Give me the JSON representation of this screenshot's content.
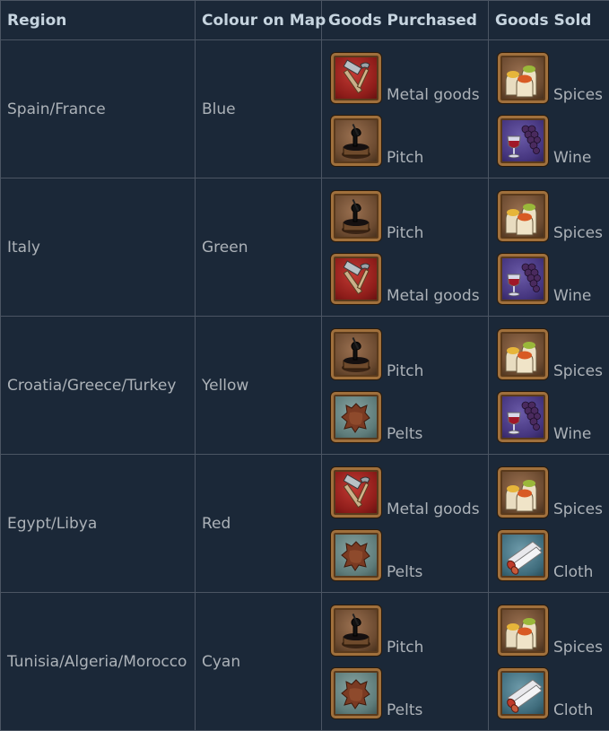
{
  "headers": {
    "region": "Region",
    "colour": "Colour on Map",
    "purchased": "Goods Purchased",
    "sold": "Goods Sold"
  },
  "rows": [
    {
      "region": "Spain/France",
      "colour": "Blue",
      "purchased": [
        {
          "label": "Metal goods",
          "icon": "metal-goods-icon"
        },
        {
          "label": "Pitch",
          "icon": "pitch-icon"
        }
      ],
      "sold": [
        {
          "label": "Spices",
          "icon": "spices-icon"
        },
        {
          "label": "Wine",
          "icon": "wine-icon"
        }
      ]
    },
    {
      "region": "Italy",
      "colour": "Green",
      "purchased": [
        {
          "label": "Pitch",
          "icon": "pitch-icon"
        },
        {
          "label": "Metal goods",
          "icon": "metal-goods-icon"
        }
      ],
      "sold": [
        {
          "label": "Spices",
          "icon": "spices-icon"
        },
        {
          "label": "Wine",
          "icon": "wine-icon"
        }
      ]
    },
    {
      "region": "Croatia/Greece/Turkey",
      "colour": "Yellow",
      "purchased": [
        {
          "label": "Pitch",
          "icon": "pitch-icon"
        },
        {
          "label": "Pelts",
          "icon": "pelts-icon"
        }
      ],
      "sold": [
        {
          "label": "Spices",
          "icon": "spices-icon"
        },
        {
          "label": "Wine",
          "icon": "wine-icon"
        }
      ]
    },
    {
      "region": "Egypt/Libya",
      "colour": "Red",
      "purchased": [
        {
          "label": "Metal goods",
          "icon": "metal-goods-icon"
        },
        {
          "label": "Pelts",
          "icon": "pelts-icon"
        }
      ],
      "sold": [
        {
          "label": "Spices",
          "icon": "spices-icon"
        },
        {
          "label": "Cloth",
          "icon": "cloth-icon"
        }
      ]
    },
    {
      "region": "Tunisia/Algeria/Morocco",
      "colour": "Cyan",
      "purchased": [
        {
          "label": "Pitch",
          "icon": "pitch-icon"
        },
        {
          "label": "Pelts",
          "icon": "pelts-icon"
        }
      ],
      "sold": [
        {
          "label": "Spices",
          "icon": "spices-icon"
        },
        {
          "label": "Cloth",
          "icon": "cloth-icon"
        }
      ]
    }
  ]
}
